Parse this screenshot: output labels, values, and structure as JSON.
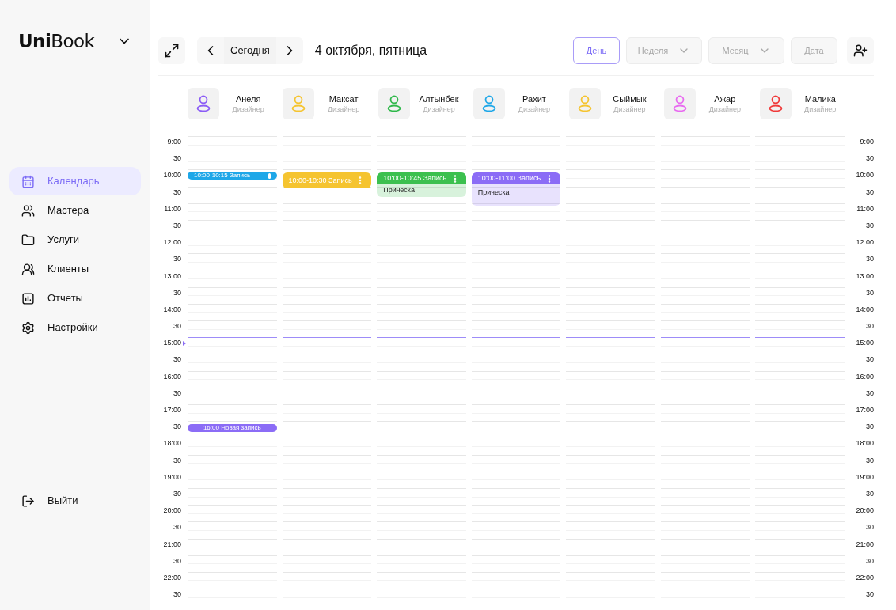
{
  "sidebar": {
    "logo": "**Uni**Book",
    "items": [
      {
        "label": "Календарь",
        "selected": true
      },
      {
        "label": "Мастера",
        "selected": false
      },
      {
        "label": "Услуги",
        "selected": false
      },
      {
        "label": "Клиенты",
        "selected": false
      },
      {
        "label": "Отчеты",
        "selected": false
      },
      {
        "label": "Настройки",
        "selected": false
      }
    ],
    "logout": "Выйти"
  },
  "toolbar": {
    "today": "Сегодня",
    "date": "4 октября, пятница",
    "views": [
      {
        "label": "День",
        "kind": "button",
        "selected": true
      },
      {
        "label": "Неделя",
        "kind": "dropdown",
        "selected": false
      },
      {
        "label": "Месяц",
        "kind": "dropdown",
        "selected": false
      },
      {
        "label": "Дата",
        "kind": "button",
        "selected": false
      }
    ]
  },
  "staff": [
    {
      "name": "Анеля",
      "role": "Дизайнер",
      "color": "#8b5cf6"
    },
    {
      "name": "Максат",
      "role": "Дизайнер",
      "color": "#f5c430"
    },
    {
      "name": "Алтынбек",
      "role": "Дизайнер",
      "color": "#2fb84a"
    },
    {
      "name": "Рахит",
      "role": "Дизайнер",
      "color": "#1ea7e8"
    },
    {
      "name": "Сыймык",
      "role": "Дизайнер",
      "color": "#f5c430"
    },
    {
      "name": "Ажар",
      "role": "Дизайнер",
      "color": "#e86af0"
    },
    {
      "name": "Малика",
      "role": "Дизайнер",
      "color": "#f03a3a"
    }
  ],
  "times": [
    {
      "label": "9:00",
      "right_label": "9:00",
      "current": false
    },
    {
      "label": "30",
      "right_label": "30",
      "current": false
    },
    {
      "label": "10:00",
      "right_label": "10:00",
      "current": false,
      "appointments": [
        {
          "kind": "pill",
          "title": "10:00-10:15 Запись",
          "color": "#1ea7e8"
        },
        {
          "kind": "block",
          "title": "10:00-10:30 Запись",
          "color": "#f5c430"
        },
        {
          "kind": "card",
          "title": "10:00-10:45 Запись",
          "detail": "Прическа",
          "color": "#3cc04f"
        },
        {
          "kind": "tall",
          "title": "10:00-11:00 Запись",
          "detail": "Прическа",
          "color": "#8b6cf6"
        }
      ]
    },
    {
      "label": "30",
      "right_label": "30",
      "current": false
    },
    {
      "label": "11:00",
      "right_label": "11:00",
      "current": false
    },
    {
      "label": "30",
      "right_label": "30",
      "current": false
    },
    {
      "label": "12:00",
      "right_label": "12:00",
      "current": false
    },
    {
      "label": "30",
      "right_label": "30",
      "current": false
    },
    {
      "label": "13:00",
      "right_label": "13:00",
      "current": false
    },
    {
      "label": "30",
      "right_label": "30",
      "current": false
    },
    {
      "label": "14:00",
      "right_label": "14:00",
      "current": false
    },
    {
      "label": "30",
      "right_label": "30",
      "current": false
    },
    {
      "label": "15:00",
      "right_label": "15:00",
      "current": true
    },
    {
      "label": "30",
      "right_label": "30",
      "current": false
    },
    {
      "label": "16:00",
      "right_label": "16:00",
      "current": false
    },
    {
      "label": "30",
      "right_label": "30",
      "current": false
    },
    {
      "label": "17:00",
      "right_label": "17:00",
      "current": false
    },
    {
      "label": "30",
      "right_label": "30",
      "current": false,
      "appointments": [
        {
          "kind": "new",
          "title": "16:00 Новая запись",
          "color": "#8b6cf6"
        }
      ]
    },
    {
      "label": "18:00",
      "right_label": "18:00",
      "current": false
    },
    {
      "label": "30",
      "right_label": "30",
      "current": false
    },
    {
      "label": "19:00",
      "right_label": "19:00",
      "current": false
    },
    {
      "label": "30",
      "right_label": "30",
      "current": false
    },
    {
      "label": "20:00",
      "right_label": "20:00",
      "current": false
    },
    {
      "label": "30",
      "right_label": "30",
      "current": false
    },
    {
      "label": "21:00",
      "right_label": "21:00",
      "current": false
    },
    {
      "label": "30",
      "right_label": "30",
      "current": false
    },
    {
      "label": "22:00",
      "right_label": "22:00",
      "current": false
    },
    {
      "label": "30",
      "right_label": "30",
      "current": false
    }
  ]
}
